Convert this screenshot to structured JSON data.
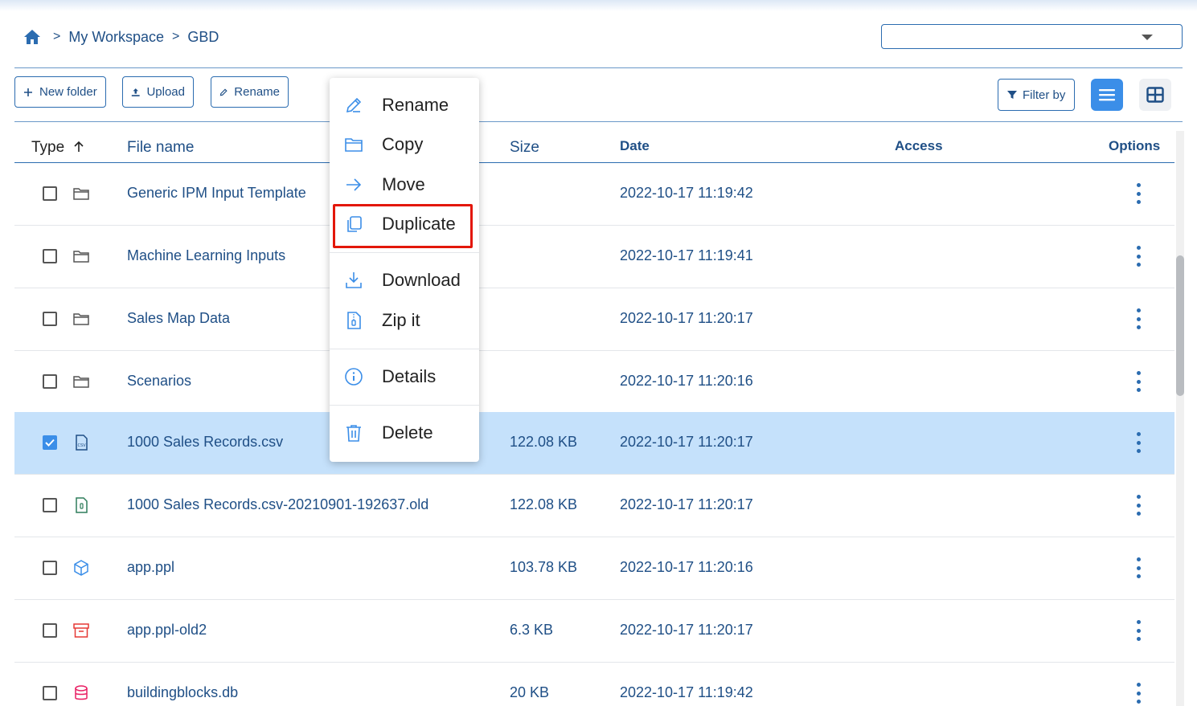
{
  "breadcrumb": {
    "items": [
      "My Workspace",
      "GBD"
    ],
    "separator": ">"
  },
  "workspace_select": {
    "value": ""
  },
  "toolbar": {
    "new_folder": "New folder",
    "upload": "Upload",
    "rename": "Rename",
    "filter": "Filter by"
  },
  "table": {
    "headers": {
      "type": "Type",
      "file_name": "File name",
      "size": "Size",
      "date": "Date",
      "access": "Access",
      "options": "Options"
    },
    "sort": {
      "column": "Type",
      "direction": "ascending"
    },
    "rows": [
      {
        "name": "Generic IPM Input Template",
        "size": "",
        "date": "2022-10-17 11:19:42",
        "icon": "folder-icon",
        "checked": false
      },
      {
        "name": "Machine Learning Inputs",
        "size": "",
        "date": "2022-10-17 11:19:41",
        "icon": "folder-icon",
        "checked": false
      },
      {
        "name": "Sales Map Data",
        "size": "",
        "date": "2022-10-17 11:20:17",
        "icon": "folder-icon",
        "checked": false
      },
      {
        "name": "Scenarios",
        "size": "",
        "date": "2022-10-17 11:20:16",
        "icon": "folder-icon",
        "checked": false
      },
      {
        "name": "1000 Sales Records.csv",
        "size": "122.08 KB",
        "date": "2022-10-17 11:20:17",
        "icon": "csv-file-icon",
        "checked": true
      },
      {
        "name": "1000 Sales Records.csv-20210901-192637.old",
        "size": "122.08 KB",
        "date": "2022-10-17 11:20:17",
        "icon": "archive-file-icon",
        "checked": false
      },
      {
        "name": "app.ppl",
        "size": "103.78 KB",
        "date": "2022-10-17 11:20:16",
        "icon": "cube-icon",
        "checked": false
      },
      {
        "name": "app.ppl-old2",
        "size": "6.3 KB",
        "date": "2022-10-17 11:20:17",
        "icon": "box-archive-icon",
        "checked": false
      },
      {
        "name": "buildingblocks.db",
        "size": "20 KB",
        "date": "2022-10-17 11:19:42",
        "icon": "database-icon",
        "checked": false
      }
    ]
  },
  "context_menu": {
    "items": [
      {
        "label": "Rename",
        "icon": "edit-icon"
      },
      {
        "label": "Copy",
        "icon": "folder-icon"
      },
      {
        "label": "Move",
        "icon": "arrow-right-icon"
      },
      {
        "label": "Duplicate",
        "icon": "duplicate-icon",
        "highlighted": true
      },
      {
        "label": "Download",
        "icon": "download-icon"
      },
      {
        "label": "Zip it",
        "icon": "zip-icon"
      },
      {
        "label": "Details",
        "icon": "info-icon"
      },
      {
        "label": "Delete",
        "icon": "trash-icon"
      }
    ]
  },
  "colors": {
    "accent": "#3b8ee8",
    "text": "#1f4f86",
    "selected_row": "#c5e1fb",
    "highlight_box": "#e3170a",
    "archive": "#e53935",
    "database": "#e91e63"
  }
}
